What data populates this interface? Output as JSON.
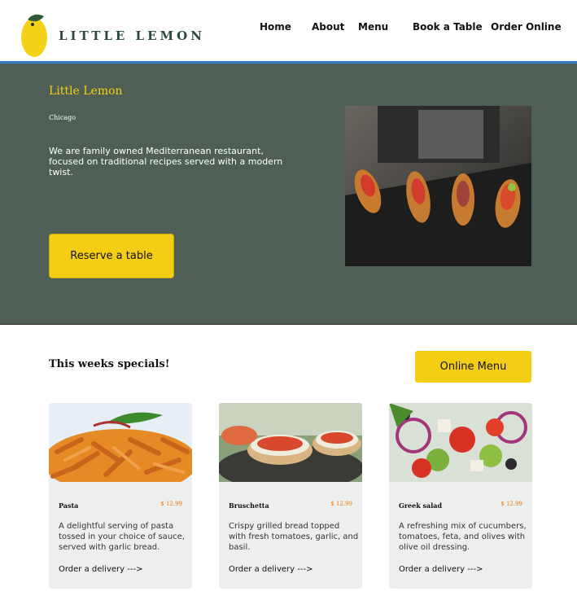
{
  "header": {
    "brand": "LITTLE LEMON",
    "nav": [
      "Home",
      "About",
      "Menu",
      "Book a Table",
      "Order Online"
    ]
  },
  "hero": {
    "title": "Little Lemon",
    "subtitle": "Chicago",
    "description": "We are family owned Mediterranean restaurant, focused on traditional recipes served with a modern twist.",
    "reserve_label": "Reserve a table"
  },
  "specials": {
    "title": "This weeks specials!",
    "online_menu_label": "Online Menu",
    "cards": [
      {
        "name": "Pasta",
        "price": "$ 12.99",
        "description": "A delightful serving of pasta tossed in your choice of sauce, served with garlic bread.",
        "order_label": "Order a delivery  --->"
      },
      {
        "name": "Bruschetta",
        "price": "$ 12.99",
        "description": "Crispy grilled bread topped with fresh tomatoes, garlic, and basil.",
        "order_label": "Order a delivery  --->"
      },
      {
        "name": "Greek  salad",
        "price": "$ 12.99",
        "description": "A refreshing mix of cucumbers, tomatoes, feta, and olives with olive oil dressing.",
        "order_label": "Order a delivery  --->"
      }
    ]
  },
  "colors": {
    "accent_yellow": "#f4ce14",
    "hero_green": "#4f5f56",
    "price_orange": "#ee7a00",
    "header_border": "#2f7fc9"
  }
}
